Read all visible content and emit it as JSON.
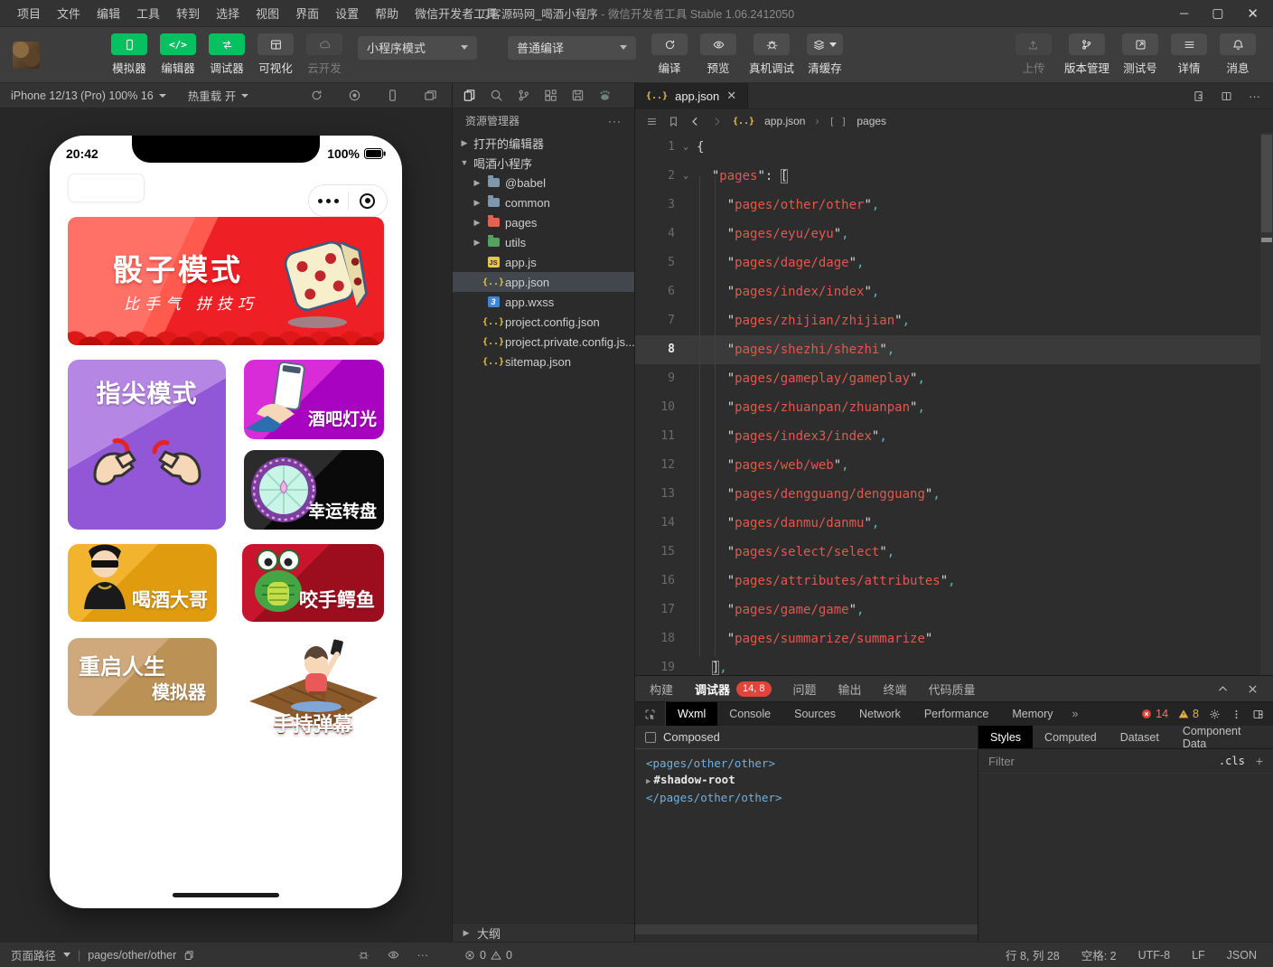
{
  "window": {
    "menus": [
      "项目",
      "文件",
      "编辑",
      "工具",
      "转到",
      "选择",
      "视图",
      "界面",
      "设置",
      "帮助",
      "微信开发者工具"
    ],
    "title_main": "刀客源码网_喝酒小程序",
    "title_suffix": "- 微信开发者工具 Stable 1.06.2412050",
    "controls": [
      "minimize-icon",
      "maximize-icon",
      "close-icon"
    ]
  },
  "toolbar": {
    "mode_buttons": [
      {
        "label": "模拟器",
        "icon": "phone",
        "state": "active"
      },
      {
        "label": "编辑器",
        "icon": "codeglyph",
        "state": "active"
      },
      {
        "label": "调试器",
        "icon": "swap",
        "state": "active"
      },
      {
        "label": "可视化",
        "icon": "grid",
        "state": "normal"
      },
      {
        "label": "云开发",
        "icon": "cloud",
        "state": "disabled"
      }
    ],
    "compile_mode": "小程序模式",
    "compile_type": "普通编译",
    "compile_actions": [
      {
        "label": "编译",
        "icon": "refresh"
      },
      {
        "label": "预览",
        "icon": "eye"
      },
      {
        "label": "真机调试",
        "icon": "bug"
      },
      {
        "label": "清缓存",
        "icon": "layers",
        "caret": true
      }
    ],
    "right_actions": [
      {
        "label": "上传",
        "icon": "upload",
        "state": "disabled"
      },
      {
        "label": "版本管理",
        "icon": "branch",
        "state": "normal"
      },
      {
        "label": "测试号",
        "icon": "external",
        "state": "normal"
      },
      {
        "label": "详情",
        "icon": "list",
        "state": "normal"
      },
      {
        "label": "消息",
        "icon": "bell",
        "state": "normal"
      }
    ]
  },
  "simulator": {
    "device": "iPhone 12/13 (Pro) 100% 16",
    "hot_reload": "热重载 开",
    "icons": [
      "rotate-icon",
      "record-icon",
      "device-icon",
      "float-window-icon"
    ]
  },
  "phone": {
    "time": "20:42",
    "battery": "100%",
    "banner": {
      "title": "骰子模式",
      "subtitle": "比手气 拼技巧"
    },
    "tiles": [
      {
        "id": "zhijian",
        "label": "指尖模式",
        "kind": "purple"
      },
      {
        "id": "jiuba",
        "label": "酒吧灯光",
        "kind": "magenta"
      },
      {
        "id": "zhuanpan",
        "label": "幸运转盘",
        "kind": "black"
      },
      {
        "id": "dage",
        "label": "喝酒大哥",
        "kind": "gold"
      },
      {
        "id": "eyu",
        "label": "咬手鳄鱼",
        "kind": "red"
      },
      {
        "id": "chongqi",
        "label": "重启人生",
        "label2": "模拟器",
        "kind": "tan"
      },
      {
        "id": "danmu",
        "label": "手持弹幕",
        "kind": "white"
      }
    ]
  },
  "explorer": {
    "toolbar_icons": [
      "files-icon",
      "search-icon",
      "branch-icon",
      "widgets-icon",
      "storage-icon",
      "paw-icon"
    ],
    "title": "资源管理器",
    "more": "···",
    "items": [
      {
        "caret": "right",
        "label": "打开的编辑器",
        "indent": 0
      },
      {
        "caret": "down",
        "label": "喝酒小程序",
        "indent": 0
      },
      {
        "caret": "right",
        "icon": "folder-blue",
        "label": "@babel",
        "indent": 1
      },
      {
        "caret": "right",
        "icon": "folder-blue",
        "label": "common",
        "indent": 1
      },
      {
        "caret": "right",
        "icon": "folder-red",
        "label": "pages",
        "indent": 1
      },
      {
        "caret": "right",
        "icon": "folder-green",
        "label": "utils",
        "indent": 1
      },
      {
        "icon": "js",
        "label": "app.js",
        "indent": 1
      },
      {
        "icon": "braces",
        "label": "app.json",
        "indent": 1,
        "selected": true
      },
      {
        "icon": "wxss",
        "label": "app.wxss",
        "indent": 1
      },
      {
        "icon": "braces",
        "label": "project.config.json",
        "indent": 1
      },
      {
        "icon": "braces",
        "label": "project.private.config.js...",
        "indent": 1
      },
      {
        "icon": "braces",
        "label": "sitemap.json",
        "indent": 1
      }
    ],
    "outline": "大纲",
    "problems": {
      "errors": "0",
      "warnings": "0"
    }
  },
  "editor": {
    "tab": "app.json",
    "breadcrumb": {
      "file": "app.json",
      "bracket": "[ ]",
      "node": "pages"
    },
    "code": {
      "lines": [
        {
          "n": 1,
          "t": "{",
          "fold": true
        },
        {
          "n": 2,
          "t": "  \"pages\": [",
          "fold": true,
          "match": true
        },
        {
          "n": 3,
          "t": "    \"pages/other/other\","
        },
        {
          "n": 4,
          "t": "    \"pages/eyu/eyu\","
        },
        {
          "n": 5,
          "t": "    \"pages/dage/dage\","
        },
        {
          "n": 6,
          "t": "    \"pages/index/index\","
        },
        {
          "n": 7,
          "t": "    \"pages/zhijian/zhijian\","
        },
        {
          "n": 8,
          "t": "    \"pages/shezhi/shezhi\",",
          "current": true
        },
        {
          "n": 9,
          "t": "    \"pages/gameplay/gameplay\","
        },
        {
          "n": 10,
          "t": "    \"pages/zhuanpan/zhuanpan\","
        },
        {
          "n": 11,
          "t": "    \"pages/index3/index\","
        },
        {
          "n": 12,
          "t": "    \"pages/web/web\","
        },
        {
          "n": 13,
          "t": "    \"pages/dengguang/dengguang\","
        },
        {
          "n": 14,
          "t": "    \"pages/danmu/danmu\","
        },
        {
          "n": 15,
          "t": "    \"pages/select/select\","
        },
        {
          "n": 16,
          "t": "    \"pages/attributes/attributes\","
        },
        {
          "n": 17,
          "t": "    \"pages/game/game\","
        },
        {
          "n": 18,
          "t": "    \"pages/summarize/summarize\""
        },
        {
          "n": 19,
          "t": "  ],",
          "match": true
        }
      ]
    }
  },
  "debugger": {
    "tabs": [
      {
        "label": "构建"
      },
      {
        "label": "调试器",
        "active": true,
        "badge": "14, 8"
      },
      {
        "label": "问题"
      },
      {
        "label": "输出"
      },
      {
        "label": "终端"
      },
      {
        "label": "代码质量"
      }
    ],
    "devtools_tabs": [
      "Wxml",
      "Console",
      "Sources",
      "Network",
      "Performance",
      "Memory"
    ],
    "more": "»",
    "errors": "14",
    "warnings": "8",
    "composed": "Composed",
    "wxml": [
      {
        "kind": "tag",
        "text": "<pages/other/other>"
      },
      {
        "kind": "shadow",
        "text": "#shadow-root"
      },
      {
        "kind": "tag",
        "text": "</pages/other/other>"
      }
    ],
    "styles_tabs": [
      "Styles",
      "Computed",
      "Dataset",
      "Component Data"
    ],
    "filter": "Filter",
    "cls": ".cls"
  },
  "statusbar": {
    "path_label": "页面路径",
    "path": "pages/other/other",
    "errors": "0",
    "warnings": "0",
    "right": [
      "行 8, 列 28",
      "空格: 2",
      "UTF-8",
      "LF",
      "JSON"
    ]
  }
}
